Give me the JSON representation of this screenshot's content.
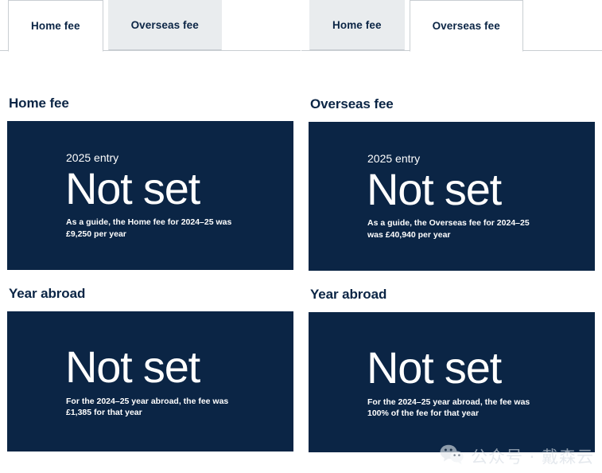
{
  "panels": [
    {
      "id": "left",
      "tabs": [
        {
          "label": "Home fee",
          "active": true
        },
        {
          "label": "Overseas fee",
          "active": false
        }
      ],
      "sections": [
        {
          "heading": "Home fee",
          "entry_year": "2025 entry",
          "value": "Not set",
          "note": "As a guide, the Home fee for 2024–25 was £9,250 per year"
        },
        {
          "heading": "Year abroad",
          "entry_year": "",
          "value": "Not set",
          "note": "For the 2024–25 year abroad, the fee was £1,385 for that year"
        }
      ]
    },
    {
      "id": "right",
      "tabs": [
        {
          "label": "Home fee",
          "active": false
        },
        {
          "label": "Overseas fee",
          "active": true
        }
      ],
      "sections": [
        {
          "heading": "Overseas fee",
          "entry_year": "2025 entry",
          "value": "Not set",
          "note": "As a guide, the Overseas fee for 2024–25 was £40,940 per year"
        },
        {
          "heading": "Year abroad",
          "entry_year": "",
          "value": "Not set",
          "note": "For the 2024–25 year abroad, the fee was 100% of the fee for that year"
        }
      ]
    }
  ],
  "watermark": {
    "text": "公众号 · 戴森云",
    "icon": "wechat-icon"
  },
  "colors": {
    "card_navy": "#0b2545",
    "heading_navy": "#0b2545",
    "tab_inactive_bg": "#e9ecee",
    "tab_border": "#c9ced2",
    "page_bg": "#ffffff"
  }
}
